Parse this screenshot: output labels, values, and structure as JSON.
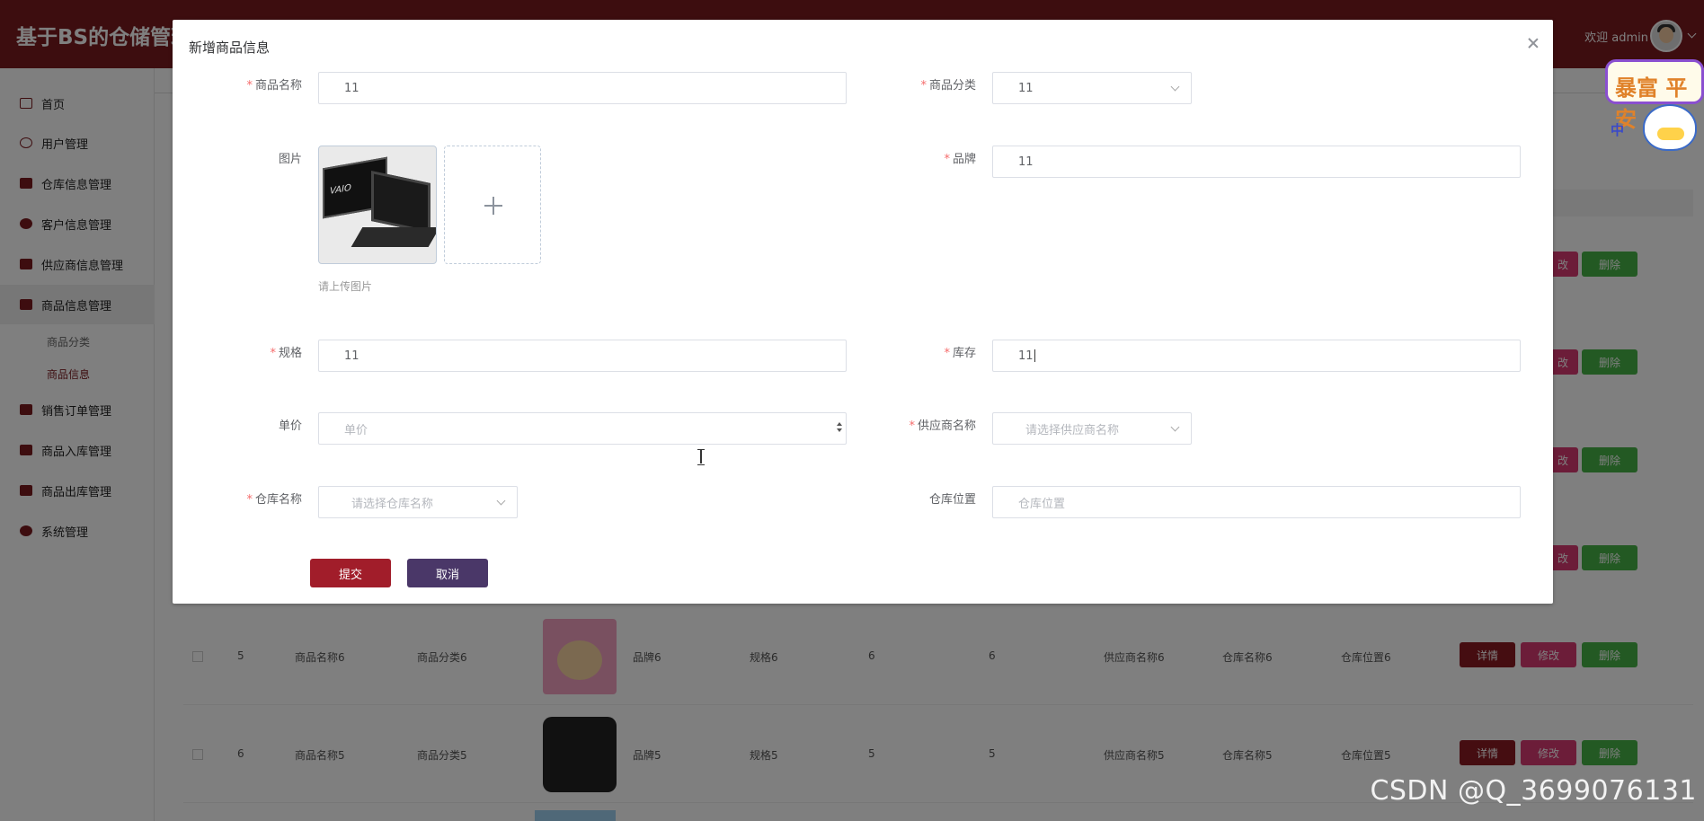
{
  "header": {
    "system_title": "基于BS的仓储管理",
    "welcome": "欢迎 admin"
  },
  "sidebar": {
    "items": [
      {
        "label": "首页",
        "icon": "home-icon"
      },
      {
        "label": "用户管理",
        "icon": "user-icon"
      },
      {
        "label": "仓库信息管理",
        "icon": "warehouse-icon"
      },
      {
        "label": "客户信息管理",
        "icon": "customer-icon"
      },
      {
        "label": "供应商信息管理",
        "icon": "supplier-icon"
      },
      {
        "label": "商品信息管理",
        "icon": "goods-icon"
      },
      {
        "label": "销售订单管理",
        "icon": "order-icon"
      },
      {
        "label": "商品入库管理",
        "icon": "inbound-icon"
      },
      {
        "label": "商品出库管理",
        "icon": "outbound-icon"
      },
      {
        "label": "系统管理",
        "icon": "system-icon"
      }
    ],
    "subitems": [
      "商品分类",
      "商品信息"
    ]
  },
  "background_table": {
    "partial_edit_label": "改",
    "delete_label": "删除",
    "rows": [
      {
        "id": "5",
        "name": "商品名称6",
        "category": "商品分类6",
        "brand": "品牌6",
        "spec": "规格6",
        "price": "6",
        "stock": "6",
        "supplier": "供应商名称6",
        "warehouse": "仓库名称6",
        "location": "仓库位置6"
      },
      {
        "id": "6",
        "name": "商品名称5",
        "category": "商品分类5",
        "brand": "品牌5",
        "spec": "规格5",
        "price": "5",
        "stock": "5",
        "supplier": "供应商名称5",
        "warehouse": "仓库名称5",
        "location": "仓库位置5"
      }
    ],
    "actions": {
      "detail": "详情",
      "edit": "修改",
      "delete": "删除"
    }
  },
  "sticker": {
    "text": "暴富 平安",
    "badge": "中"
  },
  "dialog": {
    "title": "新增商品信息",
    "fields": {
      "name": {
        "label": "商品名称",
        "value": "11"
      },
      "category": {
        "label": "商品分类",
        "value": "11"
      },
      "image": {
        "label": "图片",
        "hint": "请上传图片",
        "thumb_text": "VAIO"
      },
      "brand": {
        "label": "品牌",
        "value": "11"
      },
      "spec": {
        "label": "规格",
        "value": "11"
      },
      "stock": {
        "label": "库存",
        "value": "11"
      },
      "price": {
        "label": "单价",
        "placeholder": "单价"
      },
      "supplier": {
        "label": "供应商名称",
        "placeholder": "请选择供应商名称"
      },
      "warehouse": {
        "label": "仓库名称",
        "placeholder": "请选择仓库名称"
      },
      "location": {
        "label": "仓库位置",
        "placeholder": "仓库位置"
      }
    },
    "required_mark": "*",
    "submit_label": "提交",
    "cancel_label": "取消"
  },
  "watermark": "CSDN @Q_3699076131",
  "colors": {
    "brand": "#7a1a1f",
    "submit": "#a11d2a",
    "cancel": "#4a3768",
    "required": "#f56c6c"
  }
}
